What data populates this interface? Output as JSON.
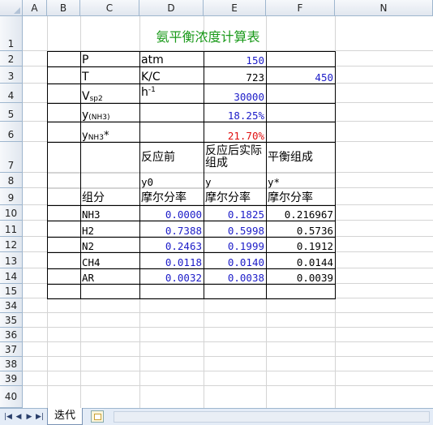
{
  "columns": [
    "A",
    "B",
    "C",
    "D",
    "E",
    "F",
    "N"
  ],
  "rows": [
    "1",
    "2",
    "3",
    "4",
    "5",
    "6",
    "7",
    "8",
    "9",
    "10",
    "11",
    "12",
    "13",
    "14",
    "15",
    "34",
    "35",
    "36",
    "37",
    "38",
    "39",
    "40"
  ],
  "title": "氨平衡浓度计算表",
  "params": {
    "P": {
      "label": "P",
      "unit": "atm",
      "value": "150"
    },
    "T": {
      "label": "T",
      "unit": "K/C",
      "value": "723",
      "extra": "450"
    },
    "V": {
      "label": "V",
      "sub": "sp2",
      "unit": "h",
      "unit_sup": "-1",
      "value": "30000"
    },
    "y_nh3": {
      "label": "y",
      "sub": "(NH3)",
      "value": "18.25%"
    },
    "y_nh3_star": {
      "label": "y",
      "sub": "NH3",
      "suffix": "*",
      "value": "21.70%"
    }
  },
  "headers": {
    "before": "反应前",
    "after": "反应后实际组成",
    "eq": "平衡组成",
    "sym_before": "y0",
    "sym_after": "y",
    "sym_eq": "y*",
    "component": "组分",
    "mole": "摩尔分率"
  },
  "components": [
    {
      "name": "NH3",
      "y0": "0.0000",
      "y": "0.1825",
      "ystar": "0.216967"
    },
    {
      "name": "H2",
      "y0": "0.7388",
      "y": "0.5998",
      "ystar": "0.5736"
    },
    {
      "name": "N2",
      "y0": "0.2463",
      "y": "0.1999",
      "ystar": "0.1912"
    },
    {
      "name": "CH4",
      "y0": "0.0118",
      "y": "0.0140",
      "ystar": "0.0144"
    },
    {
      "name": "AR",
      "y0": "0.0032",
      "y": "0.0038",
      "ystar": "0.0039"
    }
  ],
  "sheet_tab": "迭代",
  "colors": {
    "blue": "#1c1cc8",
    "red": "#e01010",
    "green": "#1a9a1a"
  }
}
